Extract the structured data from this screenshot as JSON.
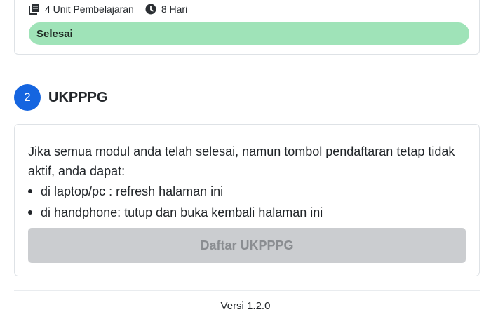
{
  "module_card": {
    "units": "4 Unit Pembelajaran",
    "units_icon": "book-icon",
    "duration": "8 Hari",
    "duration_icon": "clock-icon",
    "status": "Selesai",
    "status_color": "#9fe3b8"
  },
  "step": {
    "number": "2",
    "title": "UKPPPG",
    "badge_color": "#1565e0"
  },
  "info": {
    "text": "Jika semua modul anda telah selesai, namun tombol pendaftaran tetap tidak aktif, anda dapat:",
    "items": [
      "di laptop/pc : refresh halaman ini",
      "di handphone: tutup dan buka kembali halaman ini"
    ]
  },
  "register_button": {
    "label": "Daftar UKPPPG",
    "disabled": true
  },
  "footer": {
    "version": "Versi 1.2.0"
  }
}
